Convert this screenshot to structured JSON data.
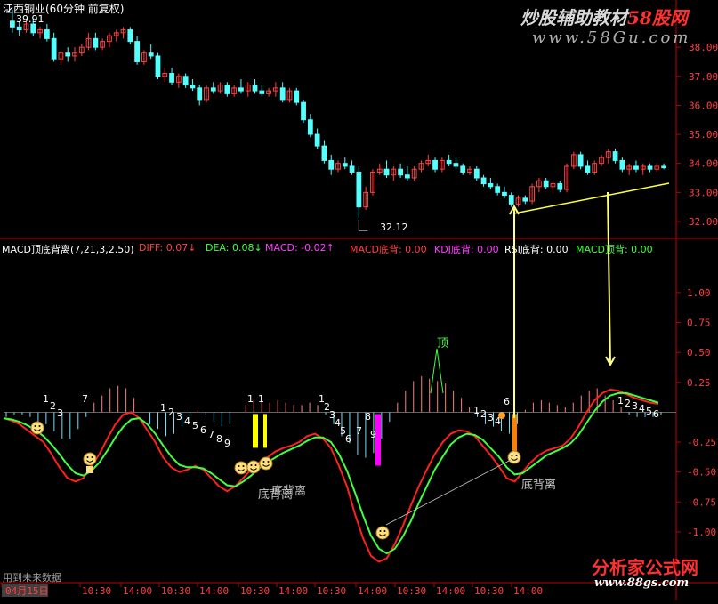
{
  "window": {
    "title": "江西铜业(60分钟 前复权)",
    "high_label": "39.91",
    "low_label": "32.12",
    "footer_text": "用到未来数据"
  },
  "watermarks": {
    "top_title": "炒股辅助教材",
    "top_brand": "58股网",
    "top_url": "www.58Gu.com",
    "bottom_brand": "分析家公式网",
    "bottom_url": "www.88gs.com"
  },
  "indicator_header": {
    "name": "MACD顶底背离",
    "params": "(7,21,3,2.50)",
    "items": [
      {
        "label": "DIFF: 0.07",
        "arrow": "↓",
        "color": "#ff4040"
      },
      {
        "label": "DEA: 0.08",
        "arrow": "↓",
        "color": "#40ff40"
      },
      {
        "label": "MACD: -0.02",
        "arrow": "↑",
        "color": "#ff40ff"
      },
      {
        "label": "MACD底背: 0.00",
        "arrow": "",
        "color": "#ff4040"
      },
      {
        "label": "KDJ底背: 0.00",
        "arrow": "",
        "color": "#ff40ff"
      },
      {
        "label": "RSI底背: 0.00",
        "arrow": "",
        "color": "#ffffff"
      },
      {
        "label": "MACD顶背: 0.00",
        "arrow": "",
        "color": "#40ff40"
      }
    ]
  },
  "annotations": {
    "top_signal": "顶",
    "divergence_label": "底背离",
    "divergence_label_overlap": "底背离"
  },
  "colors": {
    "up_candle": "#ff4040",
    "down_candle": "#54ffff",
    "diff_line": "#ff2020",
    "dea_line": "#40ff40",
    "axis": "#c00000",
    "tick_text": "#ff4040",
    "count_label": "#ffffff",
    "arrow": "#ffff80",
    "trendline": "#ffff40",
    "signal_bar_yellow": "#ffff00",
    "signal_bar_magenta": "#ff00ff",
    "smiley": "#ffe080"
  },
  "chart_data": [
    {
      "type": "candlestick",
      "title": "江西铜业(60分钟 前复权)",
      "ylim": [
        31.6,
        39.2
      ],
      "yticks": [
        32.0,
        33.0,
        34.0,
        35.0,
        36.0,
        37.0,
        38.0
      ],
      "annotated_high": 39.91,
      "annotated_low": 32.12,
      "candles": [
        [
          38.9,
          39.3,
          38.5,
          38.7
        ],
        [
          38.7,
          38.9,
          38.4,
          38.6
        ],
        [
          38.6,
          38.9,
          38.5,
          38.8
        ],
        [
          38.8,
          39.0,
          38.4,
          38.5
        ],
        [
          38.5,
          38.7,
          38.3,
          38.6
        ],
        [
          38.6,
          38.8,
          38.2,
          38.3
        ],
        [
          38.3,
          38.5,
          37.5,
          37.6
        ],
        [
          37.6,
          37.9,
          37.4,
          37.8
        ],
        [
          37.8,
          38.0,
          37.5,
          37.7
        ],
        [
          37.7,
          38.0,
          37.5,
          37.8
        ],
        [
          37.8,
          38.1,
          37.7,
          38.0
        ],
        [
          38.0,
          38.5,
          37.9,
          38.3
        ],
        [
          38.3,
          38.5,
          37.9,
          38.0
        ],
        [
          38.0,
          38.3,
          37.9,
          38.2
        ],
        [
          38.2,
          38.5,
          38.0,
          38.4
        ],
        [
          38.4,
          38.6,
          38.2,
          38.5
        ],
        [
          38.5,
          38.7,
          38.3,
          38.6
        ],
        [
          38.6,
          38.7,
          38.1,
          38.2
        ],
        [
          38.2,
          38.4,
          37.4,
          37.5
        ],
        [
          37.5,
          37.9,
          37.4,
          37.8
        ],
        [
          37.8,
          38.1,
          37.6,
          37.7
        ],
        [
          37.7,
          37.8,
          36.9,
          37.0
        ],
        [
          37.0,
          37.3,
          36.8,
          37.1
        ],
        [
          37.1,
          37.3,
          36.7,
          36.8
        ],
        [
          36.8,
          37.1,
          36.6,
          37.0
        ],
        [
          37.0,
          37.1,
          36.6,
          36.7
        ],
        [
          36.7,
          36.9,
          36.5,
          36.6
        ],
        [
          36.6,
          36.7,
          36.0,
          36.2
        ],
        [
          36.2,
          36.7,
          36.1,
          36.6
        ],
        [
          36.6,
          36.8,
          36.4,
          36.5
        ],
        [
          36.5,
          36.8,
          36.4,
          36.7
        ],
        [
          36.7,
          36.8,
          36.3,
          36.4
        ],
        [
          36.4,
          36.7,
          36.3,
          36.6
        ],
        [
          36.6,
          36.9,
          36.4,
          36.5
        ],
        [
          36.5,
          36.8,
          36.3,
          36.7
        ],
        [
          36.7,
          36.9,
          36.4,
          36.5
        ],
        [
          36.5,
          36.7,
          36.3,
          36.4
        ],
        [
          36.4,
          36.6,
          36.3,
          36.5
        ],
        [
          36.5,
          36.8,
          36.3,
          36.6
        ],
        [
          36.6,
          36.8,
          36.1,
          36.2
        ],
        [
          36.2,
          36.6,
          36.1,
          36.5
        ],
        [
          36.5,
          36.6,
          36.0,
          36.1
        ],
        [
          36.1,
          36.2,
          35.4,
          35.5
        ],
        [
          35.5,
          35.7,
          34.9,
          35.0
        ],
        [
          35.0,
          35.2,
          34.5,
          34.6
        ],
        [
          34.6,
          34.8,
          34.0,
          34.1
        ],
        [
          34.1,
          34.3,
          33.6,
          33.8
        ],
        [
          33.8,
          34.1,
          33.7,
          34.0
        ],
        [
          34.0,
          34.2,
          33.8,
          33.9
        ],
        [
          33.9,
          34.1,
          33.6,
          33.7
        ],
        [
          33.7,
          33.9,
          32.12,
          32.5
        ],
        [
          32.5,
          33.2,
          32.4,
          33.0
        ],
        [
          33.0,
          33.8,
          32.9,
          33.7
        ],
        [
          33.7,
          34.0,
          33.6,
          33.8
        ],
        [
          33.8,
          34.1,
          33.5,
          33.6
        ],
        [
          33.6,
          33.9,
          33.4,
          33.8
        ],
        [
          33.8,
          34.0,
          33.5,
          33.6
        ],
        [
          33.6,
          33.9,
          33.4,
          33.5
        ],
        [
          33.5,
          33.9,
          33.4,
          33.8
        ],
        [
          33.8,
          34.1,
          33.7,
          34.0
        ],
        [
          34.0,
          34.3,
          33.9,
          34.1
        ],
        [
          34.1,
          34.2,
          33.7,
          33.8
        ],
        [
          33.8,
          34.2,
          33.7,
          34.1
        ],
        [
          34.1,
          34.3,
          33.9,
          34.0
        ],
        [
          34.0,
          34.2,
          33.8,
          33.9
        ],
        [
          33.9,
          34.0,
          33.6,
          33.7
        ],
        [
          33.7,
          33.9,
          33.6,
          33.8
        ],
        [
          33.8,
          33.9,
          33.4,
          33.5
        ],
        [
          33.5,
          33.6,
          33.2,
          33.3
        ],
        [
          33.3,
          33.5,
          33.1,
          33.2
        ],
        [
          33.2,
          33.3,
          32.9,
          33.0
        ],
        [
          33.0,
          33.2,
          32.8,
          32.9
        ],
        [
          32.9,
          33.0,
          32.5,
          32.6
        ],
        [
          32.6,
          32.9,
          32.5,
          32.8
        ],
        [
          32.8,
          32.9,
          32.6,
          32.7
        ],
        [
          32.7,
          33.3,
          32.6,
          33.2
        ],
        [
          33.2,
          33.5,
          33.0,
          33.4
        ],
        [
          33.4,
          33.5,
          33.1,
          33.2
        ],
        [
          33.2,
          33.4,
          33.0,
          33.3
        ],
        [
          33.3,
          33.4,
          33.0,
          33.1
        ],
        [
          33.1,
          34.0,
          33.0,
          33.9
        ],
        [
          33.9,
          34.4,
          33.8,
          34.3
        ],
        [
          34.3,
          34.4,
          33.8,
          33.9
        ],
        [
          33.9,
          34.1,
          33.6,
          33.7
        ],
        [
          33.7,
          34.1,
          33.6,
          34.0
        ],
        [
          34.0,
          34.3,
          33.9,
          34.2
        ],
        [
          34.2,
          34.5,
          34.0,
          34.4
        ],
        [
          34.4,
          34.5,
          34.0,
          34.1
        ],
        [
          34.1,
          34.2,
          33.7,
          33.8
        ],
        [
          33.8,
          34.0,
          33.6,
          33.9
        ],
        [
          33.9,
          34.1,
          33.7,
          33.8
        ],
        [
          33.8,
          34.0,
          33.6,
          33.9
        ],
        [
          33.9,
          34.0,
          33.7,
          33.8
        ],
        [
          33.8,
          34.0,
          33.7,
          33.9
        ],
        [
          33.9,
          34.0,
          33.8,
          33.85
        ]
      ]
    },
    {
      "type": "line",
      "title": "MACD顶底背离",
      "ylim": [
        -1.35,
        1.2
      ],
      "yticks": [
        -1.0,
        -0.75,
        -0.5,
        -0.25,
        0.25,
        0.5,
        0.75,
        1.0
      ],
      "series": [
        {
          "name": "DIFF",
          "values": [
            -0.05,
            -0.07,
            -0.1,
            -0.15,
            -0.2,
            -0.25,
            -0.35,
            -0.46,
            -0.55,
            -0.58,
            -0.55,
            -0.45,
            -0.35,
            -0.22,
            -0.1,
            -0.02,
            0.0,
            -0.05,
            -0.15,
            -0.25,
            -0.38,
            -0.46,
            -0.5,
            -0.48,
            -0.45,
            -0.48,
            -0.55,
            -0.62,
            -0.66,
            -0.62,
            -0.55,
            -0.48,
            -0.42,
            -0.38,
            -0.33,
            -0.3,
            -0.28,
            -0.25,
            -0.2,
            -0.18,
            -0.22,
            -0.3,
            -0.45,
            -0.62,
            -0.85,
            -1.05,
            -1.2,
            -1.25,
            -1.22,
            -1.1,
            -0.95,
            -0.78,
            -0.62,
            -0.48,
            -0.35,
            -0.25,
            -0.18,
            -0.15,
            -0.16,
            -0.2,
            -0.28,
            -0.36,
            -0.45,
            -0.55,
            -0.58,
            -0.5,
            -0.42,
            -0.36,
            -0.32,
            -0.3,
            -0.28,
            -0.22,
            -0.12,
            0.0,
            0.1,
            0.16,
            0.19,
            0.18,
            0.15,
            0.12,
            0.1,
            0.08,
            0.07
          ]
        },
        {
          "name": "DEA",
          "values": [
            -0.05,
            -0.06,
            -0.08,
            -0.11,
            -0.15,
            -0.2,
            -0.27,
            -0.35,
            -0.44,
            -0.51,
            -0.53,
            -0.49,
            -0.42,
            -0.32,
            -0.21,
            -0.12,
            -0.06,
            -0.05,
            -0.1,
            -0.18,
            -0.28,
            -0.37,
            -0.44,
            -0.46,
            -0.46,
            -0.47,
            -0.51,
            -0.56,
            -0.61,
            -0.62,
            -0.58,
            -0.53,
            -0.47,
            -0.42,
            -0.38,
            -0.34,
            -0.31,
            -0.28,
            -0.24,
            -0.21,
            -0.21,
            -0.25,
            -0.35,
            -0.49,
            -0.67,
            -0.86,
            -1.03,
            -1.14,
            -1.18,
            -1.14,
            -1.04,
            -0.91,
            -0.76,
            -0.62,
            -0.48,
            -0.37,
            -0.27,
            -0.21,
            -0.18,
            -0.19,
            -0.23,
            -0.3,
            -0.37,
            -0.46,
            -0.52,
            -0.51,
            -0.46,
            -0.41,
            -0.36,
            -0.33,
            -0.3,
            -0.26,
            -0.19,
            -0.09,
            0.01,
            0.09,
            0.14,
            0.16,
            0.16,
            0.14,
            0.12,
            0.1,
            0.08
          ]
        }
      ],
      "histogram": [
        -0.04,
        -0.02,
        -0.02,
        -0.04,
        -0.1,
        -0.1,
        -0.16,
        -0.22,
        -0.22,
        -0.14,
        -0.04,
        0.08,
        0.14,
        0.2,
        0.22,
        0.2,
        0.12,
        0.0,
        -0.1,
        -0.14,
        -0.2,
        -0.18,
        -0.12,
        -0.04,
        0.02,
        -0.02,
        -0.08,
        -0.12,
        -0.1,
        0.0,
        0.06,
        0.1,
        0.1,
        0.08,
        0.1,
        0.08,
        0.06,
        0.06,
        0.08,
        0.06,
        -0.02,
        -0.1,
        -0.2,
        -0.26,
        -0.36,
        -0.38,
        -0.34,
        -0.22,
        -0.08,
        0.08,
        0.18,
        0.26,
        0.3,
        0.28,
        0.26,
        0.24,
        0.18,
        0.12,
        0.04,
        -0.04,
        -0.1,
        -0.12,
        -0.16,
        -0.18,
        -0.1,
        0.02,
        0.08,
        0.1,
        0.08,
        0.06,
        0.04,
        0.08,
        0.14,
        0.18,
        0.2,
        0.14,
        0.1,
        0.04,
        -0.02,
        -0.04,
        -0.04,
        -0.04,
        -0.02
      ],
      "signals": {
        "top_label": "顶",
        "bottom_label": "底背离"
      },
      "count_labels": [
        "1",
        "2",
        "3",
        "4",
        "5",
        "6",
        "7",
        "8",
        "9"
      ]
    }
  ],
  "x_axis": {
    "labels": [
      "04月15日",
      "10:30",
      "14:00",
      "10:30",
      "14:00",
      "10:30",
      "14:00",
      "10:30",
      "14:00",
      "10:30",
      "14:00",
      "10:30",
      "14:00"
    ]
  }
}
